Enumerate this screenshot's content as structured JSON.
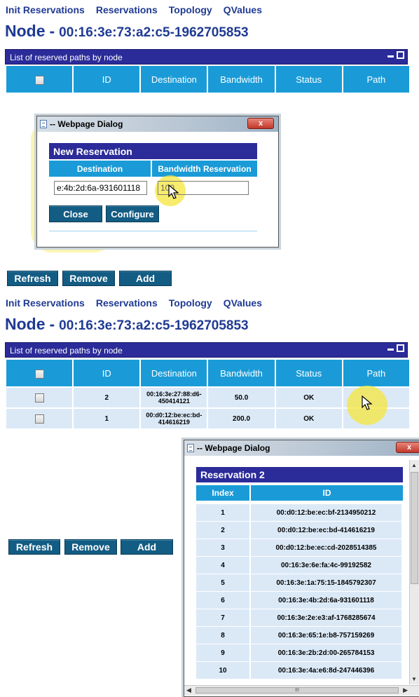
{
  "nav": [
    "Init Reservations",
    "Reservations",
    "Topology",
    "QValues"
  ],
  "node": {
    "label": "Node",
    "dash": "-",
    "id": "00:16:3e:73:a2:c5-1962705853"
  },
  "panel": {
    "title": "List of reserved paths by node"
  },
  "columns": [
    "ID",
    "Destination",
    "Bandwidth",
    "Status",
    "Path"
  ],
  "rows": [
    {
      "id": "2",
      "destination": "00:16:3e:27:88:d6-450414121",
      "bandwidth": "50.0",
      "status": "OK"
    },
    {
      "id": "1",
      "destination": "00:d0:12:be:ec:bd-414616219",
      "bandwidth": "200.0",
      "status": "OK"
    }
  ],
  "buttons": {
    "refresh": "Refresh",
    "remove": "Remove",
    "add": "Add"
  },
  "dialog1": {
    "title": "-- Webpage Dialog",
    "close_glyph": "x",
    "header": "New Reservation",
    "col_destination": "Destination",
    "col_bandwidth": "Bandwidth Reservation",
    "destination_value": "e:4b:2d:6a-931601118",
    "bandwidth_value": "100",
    "close_button": "Close",
    "configure_button": "Configure"
  },
  "dialog2": {
    "title": "-- Webpage Dialog",
    "close_glyph": "x",
    "header": "Reservation 2",
    "col_index": "Index",
    "col_id": "ID",
    "scroll_grip": "III",
    "rows": [
      {
        "index": "1",
        "id": "00:d0:12:be:ec:bf-2134950212"
      },
      {
        "index": "2",
        "id": "00:d0:12:be:ec:bd-414616219"
      },
      {
        "index": "3",
        "id": "00:d0:12:be:ec:cd-2028514385"
      },
      {
        "index": "4",
        "id": "00:16:3e:6e:fa:4c-99192582"
      },
      {
        "index": "5",
        "id": "00:16:3e:1a:75:15-1845792307"
      },
      {
        "index": "6",
        "id": "00:16:3e:4b:2d:6a-931601118"
      },
      {
        "index": "7",
        "id": "00:16:3e:2e:e3:af-1768285674"
      },
      {
        "index": "8",
        "id": "00:16:3e:65:1e:b8-757159269"
      },
      {
        "index": "9",
        "id": "00:16:3e:2b:2d:00-265784153"
      },
      {
        "index": "10",
        "id": "00:16:3e:4a:e6:8d-247446396"
      }
    ]
  }
}
